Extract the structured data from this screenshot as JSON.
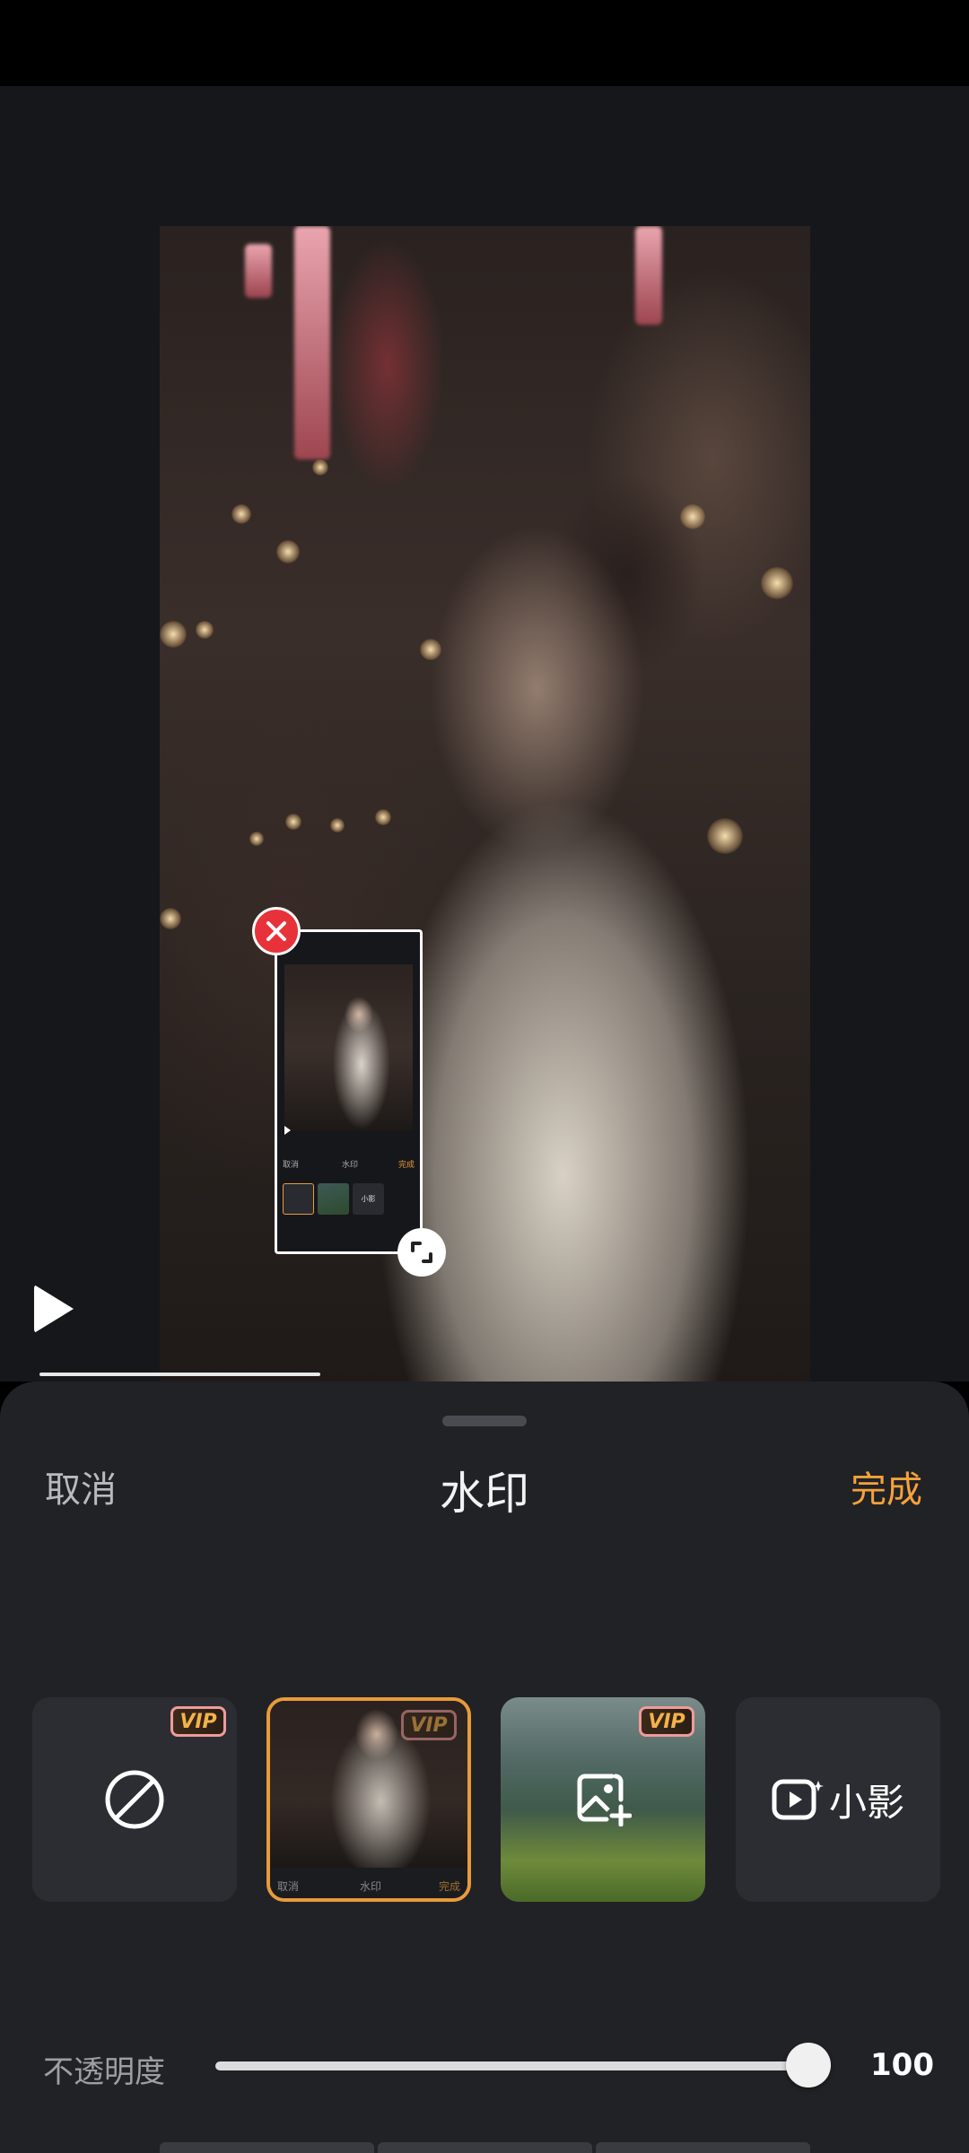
{
  "header": {
    "cancel_label": "取消",
    "title": "水印",
    "done_label": "完成"
  },
  "colors": {
    "accent": "#f5a23a",
    "sheet_bg": "#212226",
    "close_red": "#e8323a"
  },
  "watermark_preview": {
    "cancel_label": "取消",
    "title": "水印",
    "done_label": "完成",
    "brand": "小影"
  },
  "options": [
    {
      "name": "none",
      "icon": "no-watermark-icon",
      "vip": "VIP"
    },
    {
      "name": "screenshot",
      "selected": true,
      "vip": "VIP",
      "cancel_label": "取消",
      "title": "水印",
      "done_label": "完成"
    },
    {
      "name": "custom-image",
      "icon": "add-image-icon",
      "vip": "VIP"
    },
    {
      "name": "xiaoying",
      "icon": "xiaoying-logo-icon",
      "label": "小影"
    }
  ],
  "opacity": {
    "label": "不透明度",
    "value": "100",
    "fraction": 1.0
  },
  "playback": {
    "progress_fraction": 0.29
  }
}
